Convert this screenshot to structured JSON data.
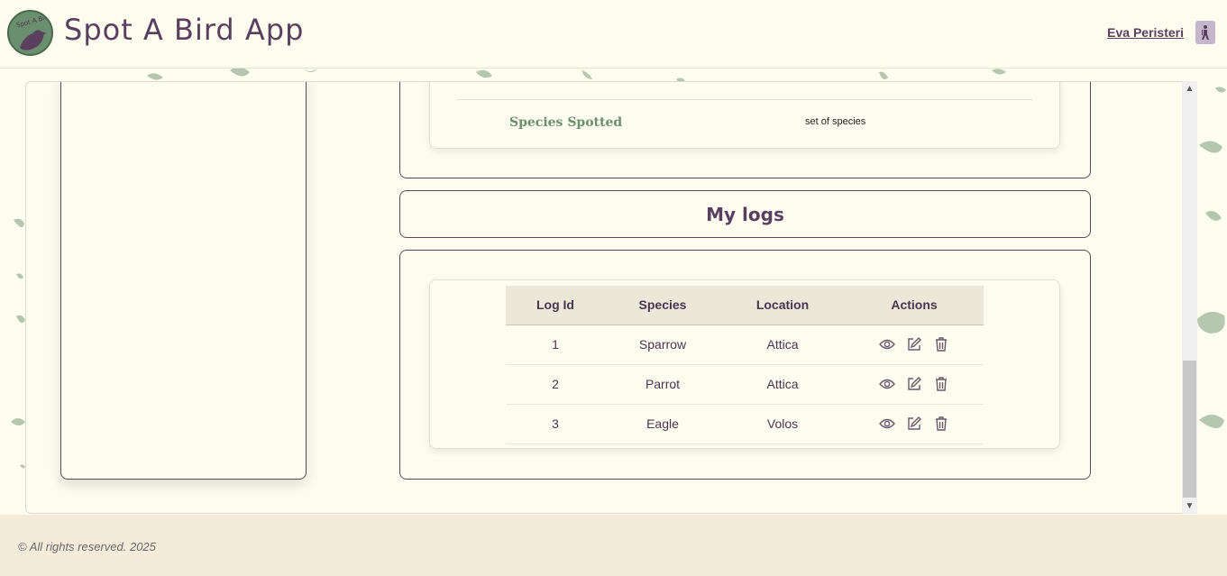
{
  "header": {
    "logo_text": "Spot A Bird",
    "title": "Spot A Bird App",
    "user_name": "Eva Peristeri",
    "user_icon": "hiker-icon"
  },
  "profile": {
    "species_label": "Species Spotted",
    "species_value": "set of species"
  },
  "logs": {
    "title": "My logs",
    "columns": [
      "Log Id",
      "Species",
      "Location",
      "Actions"
    ],
    "rows": [
      {
        "id": "1",
        "species": "Sparrow",
        "location": "Attica"
      },
      {
        "id": "2",
        "species": "Parrot",
        "location": "Attica"
      },
      {
        "id": "3",
        "species": "Eagle",
        "location": "Volos"
      }
    ],
    "action_icons": [
      "eye-icon",
      "edit-icon",
      "trash-icon"
    ]
  },
  "footer": {
    "text": "© All rights reserved. 2025"
  },
  "colors": {
    "background": "#fdfcee",
    "brand_purple": "#5a3f5f",
    "brand_green": "#6b8f6e",
    "footer_bg": "#f4ecd9"
  }
}
